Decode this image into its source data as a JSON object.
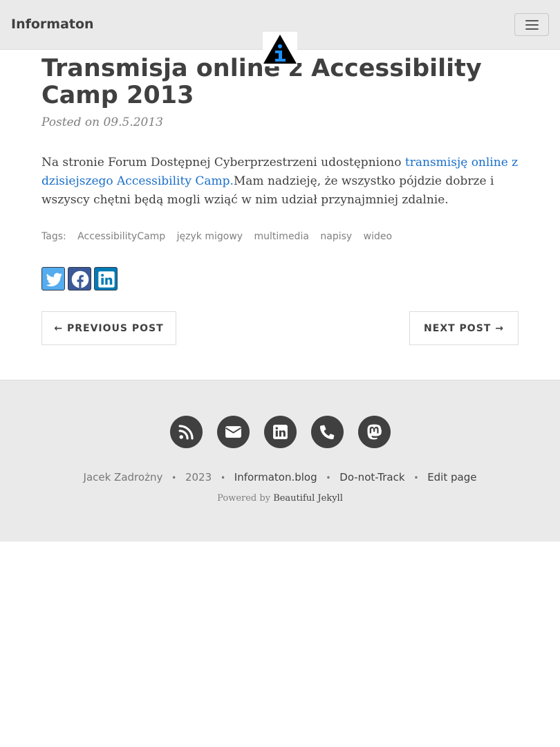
{
  "navbar": {
    "brand": "Informaton",
    "menu_icon": "hamburger-menu-icon"
  },
  "logo": {
    "icon": "info-triangle-logo",
    "colors": {
      "triangle": "#000000",
      "letter": "#1e90ff"
    }
  },
  "post": {
    "title": "Transmisja online z Accessibility Camp 2013",
    "meta": "Posted on 09.5.2013",
    "body_before_link": "Na stronie Forum Dostępnej Cyberprzestrzeni udostępniono ",
    "link_text": "transmisję online z dzisiejszego Accessibility Camp.",
    "body_after_link": "Mam nadzieję, że wszystko pójdzie dobrze i wszyscy chętni będą mogli wziąć w nim udział przynajmniej zdalnie.",
    "link_color": "#1a6fc9"
  },
  "tags": {
    "label": "Tags:",
    "items": [
      "AccessibilityCamp",
      "język migowy",
      "multimedia",
      "napisy",
      "wideo"
    ]
  },
  "share": {
    "buttons": [
      {
        "icon": "twitter-icon",
        "color": "#55acee"
      },
      {
        "icon": "facebook-icon",
        "color": "#3b5998"
      },
      {
        "icon": "linkedin-icon",
        "color": "#007bb5"
      }
    ]
  },
  "pager": {
    "previous": "← Previous Post",
    "next": "Next Post →"
  },
  "footer": {
    "social_icons": [
      "rss-icon",
      "envelope-icon",
      "linkedin-icon",
      "phone-icon",
      "mastodon-icon"
    ],
    "author": "Jacek Zadrożny",
    "year": "2023",
    "site": "Informaton.blog",
    "dnt": "Do-not-Track",
    "edit": "Edit page",
    "separator": "•",
    "powered_prefix": "Powered by",
    "powered_link": "Beautiful Jekyll"
  }
}
